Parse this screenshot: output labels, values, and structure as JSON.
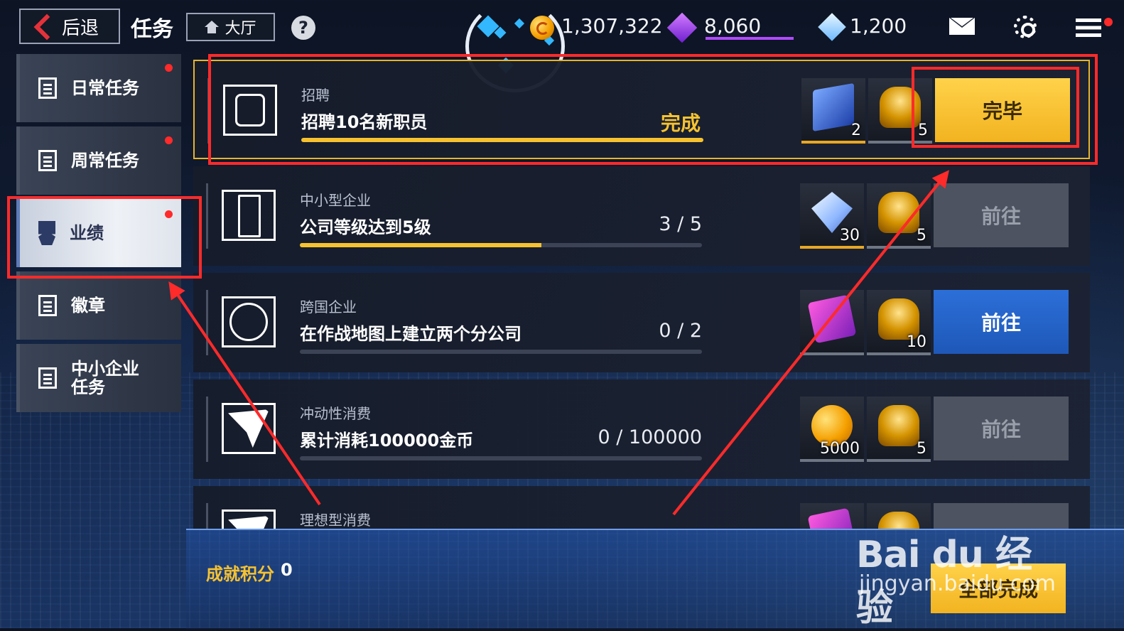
{
  "topbar": {
    "back_label": "后退",
    "title": "任务",
    "lobby_label": "大厅",
    "help_label": "?",
    "currency": [
      {
        "name": "gold-coin",
        "value": "1,307,322"
      },
      {
        "name": "purple-crystal",
        "value": "8,060"
      },
      {
        "name": "blue-diamond",
        "value": "1,200"
      }
    ]
  },
  "sidebar": {
    "items": [
      {
        "label": "日常任务",
        "active": false,
        "badge": true
      },
      {
        "label": "周常任务",
        "active": false,
        "badge": true
      },
      {
        "label": "业绩",
        "active": true,
        "badge": true
      },
      {
        "label": "徽章",
        "active": false,
        "badge": false
      },
      {
        "label": "中小企业\n任务",
        "active": false,
        "badge": false
      }
    ]
  },
  "tasks": [
    {
      "category": "招聘",
      "description": "招聘10名新职员",
      "progress_text": "完成",
      "progress": 1.0,
      "rewards": [
        {
          "icon": "book-icon",
          "count": "2"
        },
        {
          "icon": "trophy-icon",
          "count": "5"
        }
      ],
      "action": "完毕",
      "action_state": "claim",
      "done": true
    },
    {
      "category": "中小型企业",
      "description": "公司等级达到5级",
      "progress_text": "3 / 5",
      "progress": 0.6,
      "rewards": [
        {
          "icon": "gem-icon",
          "count": "30"
        },
        {
          "icon": "trophy-icon",
          "count": "5"
        }
      ],
      "action": "前往",
      "action_state": "go-disabled",
      "done": false
    },
    {
      "category": "跨国企业",
      "description": "在作战地图上建立两个分公司",
      "progress_text": "0 / 2",
      "progress": 0.0,
      "rewards": [
        {
          "icon": "card-icon",
          "count": ""
        },
        {
          "icon": "trophy-icon",
          "count": "10"
        }
      ],
      "action": "前往",
      "action_state": "go-active",
      "done": false
    },
    {
      "category": "冲动性消费",
      "description": "累计消耗100000金币",
      "progress_text": "0 / 100000",
      "progress": 0.0,
      "rewards": [
        {
          "icon": "coin-icon",
          "count": "5000"
        },
        {
          "icon": "trophy-icon",
          "count": "5"
        }
      ],
      "action": "前往",
      "action_state": "go-disabled",
      "done": false
    },
    {
      "category": "理想型消费",
      "description": "",
      "progress_text": "",
      "progress": 0.0,
      "rewards": [
        {
          "icon": "crystal-icon",
          "count": ""
        },
        {
          "icon": "trophy-icon",
          "count": ""
        }
      ],
      "action": "",
      "action_state": "go-disabled",
      "done": false
    }
  ],
  "footer": {
    "score_label": "成就积分",
    "score_value": "0",
    "all_button": "全部完成"
  },
  "watermark": {
    "line1": "Bai du 经验",
    "line2": "jingyan.baidu.com"
  },
  "colors": {
    "accent": "#f6c230",
    "blue_button": "#1e58b8",
    "annotation": "#ff2a2a"
  }
}
